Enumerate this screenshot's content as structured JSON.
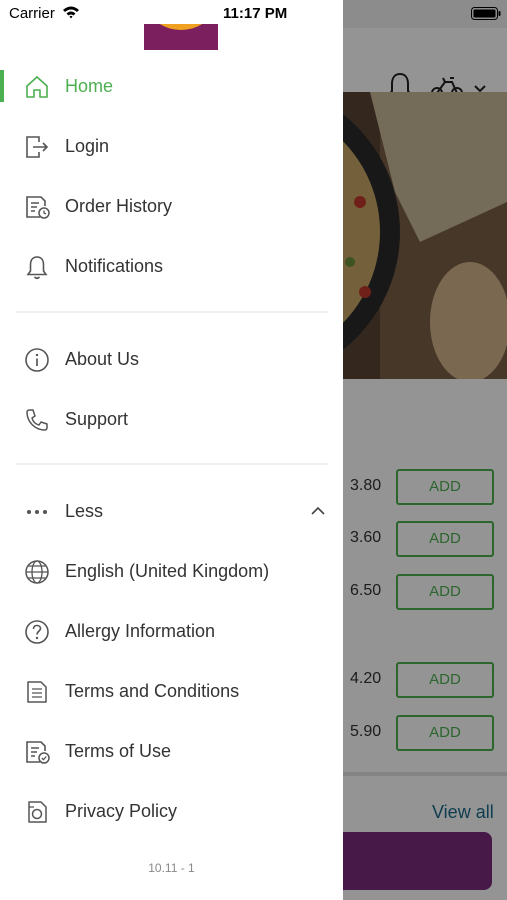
{
  "status_bar": {
    "carrier": "Carrier",
    "time": "11:17 PM"
  },
  "drawer": {
    "primary": [
      {
        "label": "Home",
        "icon": "home-icon",
        "active": true
      },
      {
        "label": "Login",
        "icon": "login-icon"
      },
      {
        "label": "Order History",
        "icon": "order-history-icon"
      },
      {
        "label": "Notifications",
        "icon": "bell-icon"
      }
    ],
    "secondary": [
      {
        "label": "About Us",
        "icon": "info-icon"
      },
      {
        "label": "Support",
        "icon": "phone-icon"
      }
    ],
    "more_toggle": {
      "label": "Less",
      "icon": "more-dots-icon",
      "expanded": true
    },
    "more_items": [
      {
        "label": "English (United Kingdom)",
        "icon": "globe-icon"
      },
      {
        "label": "Allergy Information",
        "icon": "question-icon"
      },
      {
        "label": "Terms and Conditions",
        "icon": "document-icon"
      },
      {
        "label": "Terms of Use",
        "icon": "document-check-icon"
      },
      {
        "label": "Privacy Policy",
        "icon": "shield-doc-icon"
      }
    ],
    "version": "10.11 - 1"
  },
  "background_app": {
    "prices": [
      "3.80",
      "3.60",
      "6.50",
      "4.20",
      "5.90"
    ],
    "add_label": "ADD",
    "view_all": "View all"
  },
  "colors": {
    "accent": "#4caf50",
    "brand": "#7a2b7f",
    "link": "#1a6a8a",
    "text": "#333333"
  }
}
